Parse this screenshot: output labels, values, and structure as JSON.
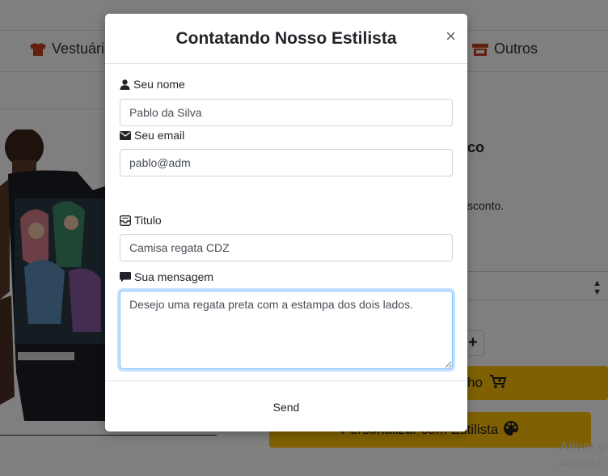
{
  "nav": {
    "items": [
      {
        "label": "Vestuário",
        "icon": "shirt-icon"
      },
      {
        "label": "Outros",
        "icon": "store-icon"
      }
    ]
  },
  "product": {
    "title_fragment": "co",
    "desc_fragment": "sconto.",
    "cart_label_fragment": "ho",
    "stylist_button": "Personalizar com Estilista"
  },
  "watermark": {
    "line1": "Ativar o",
    "line2": "Acesse C"
  },
  "modal": {
    "title": "Contatando Nosso Estilista",
    "close_label": "×",
    "fields": {
      "name_label": "Seu nome",
      "name_value": "Pablo da Silva",
      "email_label": "Seu email",
      "email_value": "pablo@adm",
      "title_label": "Titulo",
      "title_value": "Camisa regata CDZ",
      "message_label": "Sua mensagem",
      "message_value": "Desejo uma regata preta com a estampa dos dois lados."
    },
    "send_label": "Send"
  },
  "colors": {
    "accent": "#ffc107",
    "brand_icon": "#c9401b",
    "focus_border": "#80bdff"
  }
}
